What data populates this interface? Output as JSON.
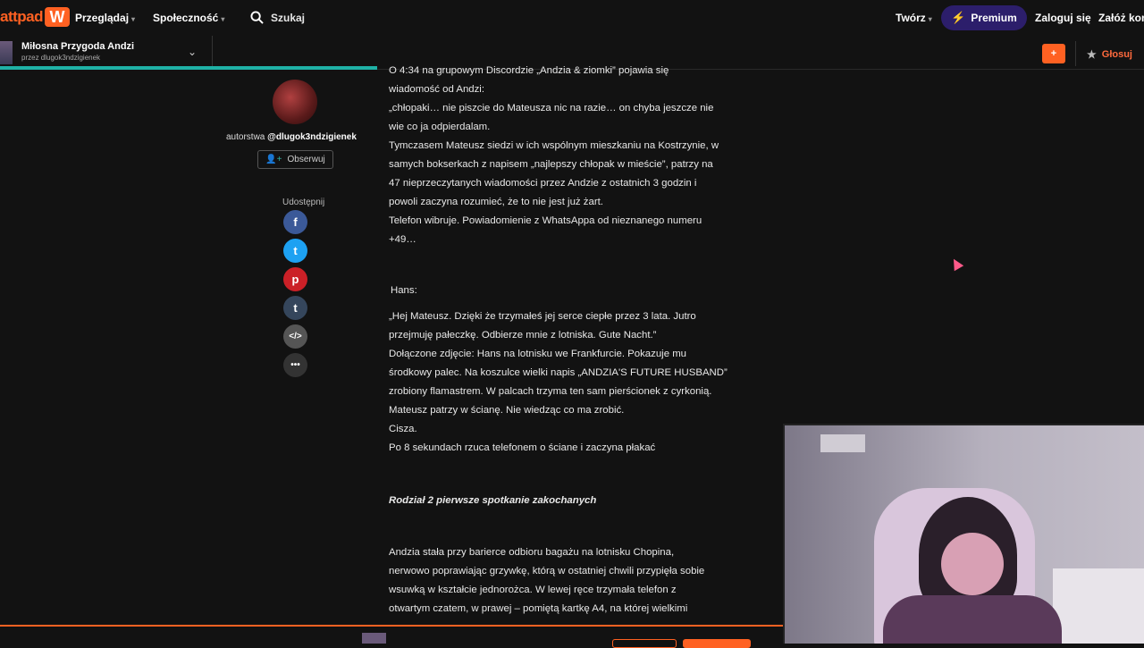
{
  "nav": {
    "logo_text": "attpad",
    "logo_mark": "W",
    "browse": "Przeglądaj",
    "community": "Społeczność",
    "search": "Szukaj",
    "write": "Twórz",
    "premium": "Premium",
    "login": "Zaloguj się",
    "signup": "Załóż kont"
  },
  "story": {
    "title": "Miłosna Przygoda Andzi",
    "author_line": "przez dlugok3ndzigienek",
    "add": "+",
    "vote": "Głosuj"
  },
  "sidebar": {
    "byline_prefix": "autorstwa",
    "author_handle": "@dlugok3ndzigienek",
    "follow": "Obserwuj",
    "share_label": "Udostępnij",
    "share": [
      {
        "icon": "facebook-icon",
        "glyph": "f",
        "color": "#3b5998"
      },
      {
        "icon": "twitter-icon",
        "glyph": "t",
        "color": "#1da1f2"
      },
      {
        "icon": "pinterest-icon",
        "glyph": "p",
        "color": "#cb2027"
      },
      {
        "icon": "tumblr-icon",
        "glyph": "t",
        "color": "#35465c"
      },
      {
        "icon": "embed-icon",
        "glyph": "</>",
        "color": "#555555"
      },
      {
        "icon": "more-icon",
        "glyph": "•••",
        "color": "#333333"
      }
    ]
  },
  "content": {
    "lines_a": [
      "O 4:34 na grupowym Discordzie „Andzia & ziomki” pojawia się",
      "wiadomość od Andzi:",
      "„chłopaki… nie piszcie do Mateusza nic na razie… on chyba jeszcze nie",
      "wie co ja odpierdalam.",
      "Tymczasem Mateusz siedzi w ich wspólnym mieszkaniu na Kostrzynie, w",
      "samych bokserkach z napisem „najlepszy chłopak w mieście”, patrzy na",
      "47 nieprzeczytanych wiadomości przez Andzie z ostatnich 3 godzin i",
      "powoli zaczyna rozumieć, że to nie jest już żart.",
      "Telefon wibruje. Powiadomienie z WhatsAppa od nieznanego numeru",
      "+49…"
    ],
    "hans": "Hans:",
    "lines_b": [
      "„Hej Mateusz. Dzięki że trzymałeś jej serce ciepłe przez 3 lata. Jutro",
      "przejmuję pałeczkę. Odbierze mnie z lotniska. Gute Nacht.”",
      "Dołączone zdjęcie: Hans na lotnisku we Frankfurcie. Pokazuje mu",
      "środkowy palec. Na koszulce wielki napis „ANDZIA'S FUTURE HUSBAND”",
      "zrobiony flamastrem. W palcach trzyma ten sam pierścionek z cyrkonią.",
      "Mateusz patrzy w ścianę. Nie wiedząc co ma zrobić.",
      "Cisza.",
      "Po 8 sekundach rzuca telefonem o ściane i zaczyna płakać"
    ],
    "chapter": "Rodział 2 pierwsze spotkanie zakochanych",
    "lines_c": [
      "Andzia stała przy barierce odbioru bagażu na lotnisku Chopina,",
      "nerwowo poprawiając grzywkę, którą w ostatniej chwili przypięła sobie",
      "wsuwką w kształcie jednorożca. W lewej ręce trzymała telefon z",
      "otwartym czatem, w prawej – pomiętą kartkę A4, na której wielkimi"
    ]
  },
  "colors": {
    "brand": "#ff6122",
    "progress": "#1fb2a6",
    "premium_bg": "#2c1e6b"
  },
  "reading_progress": 0.33
}
